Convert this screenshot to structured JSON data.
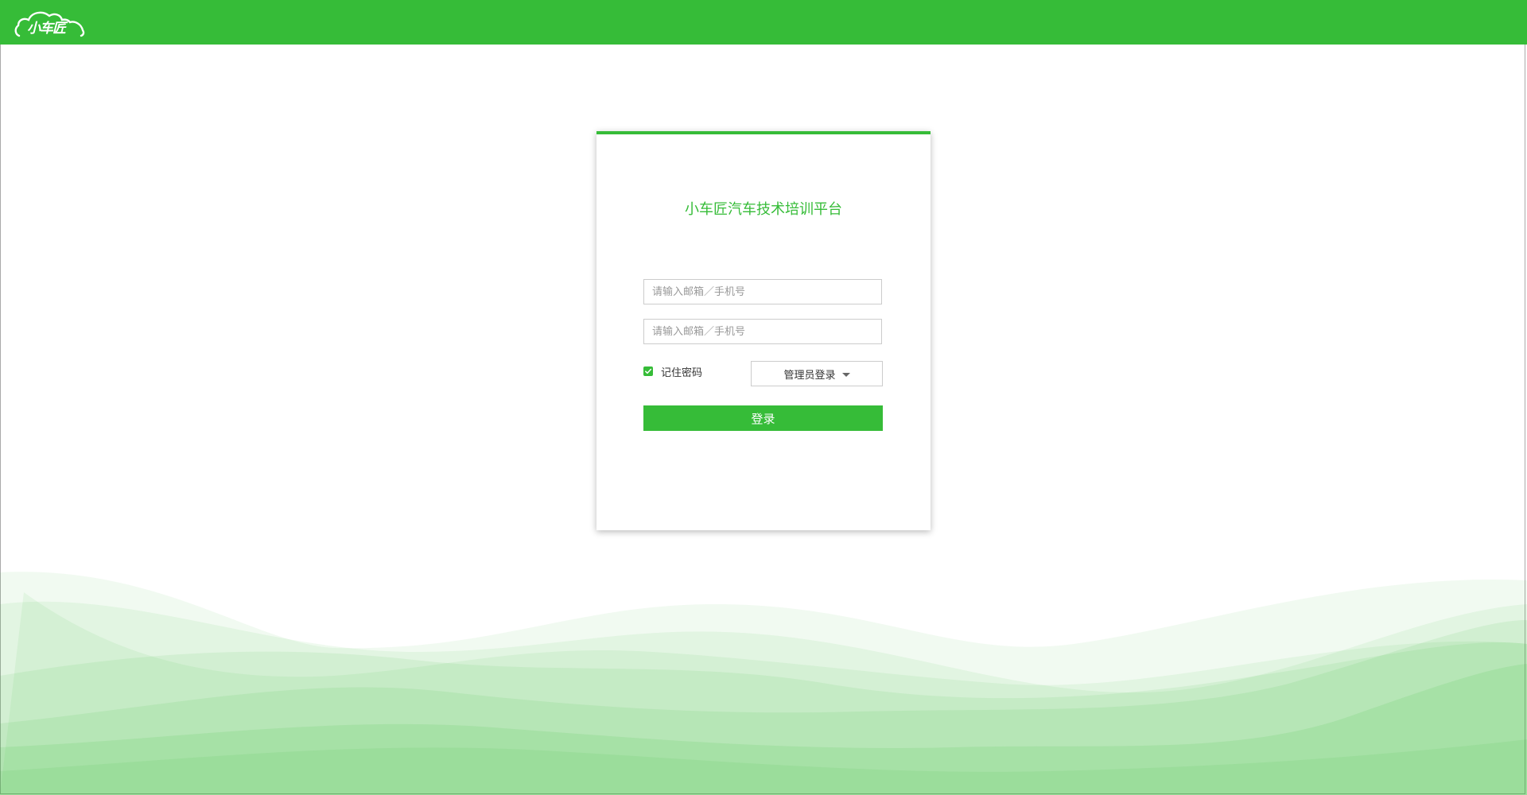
{
  "header": {
    "logo_text": "小车匠"
  },
  "login": {
    "title": "小车匠汽车技术培训平台",
    "account_placeholder": "请输入邮箱／手机号",
    "password_placeholder": "请输入邮箱／手机号",
    "remember_label": "记住密码",
    "remember_checked": true,
    "role_selected": "管理员登录",
    "submit_label": "登录"
  },
  "colors": {
    "brand": "#36bc38"
  },
  "icons": {
    "logo": "cloud-logo-icon",
    "checkbox": "checkmark-icon",
    "dropdown": "caret-down-icon"
  }
}
